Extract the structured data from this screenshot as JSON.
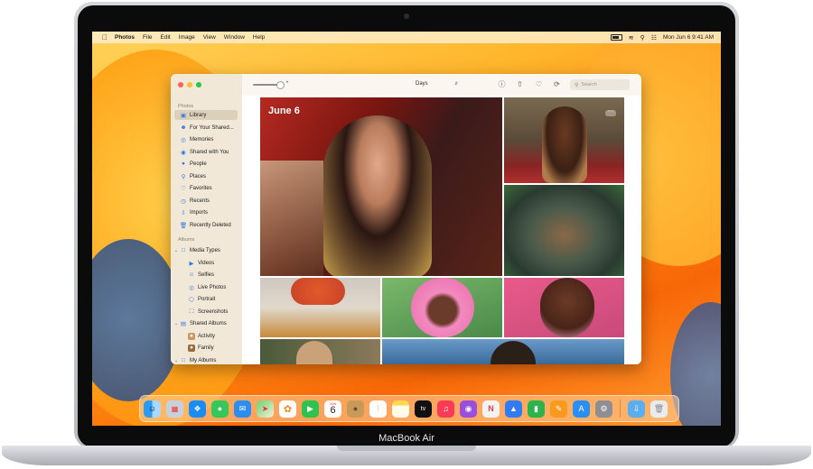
{
  "device": {
    "brand_label": "MacBook Air"
  },
  "menubar": {
    "apple_icon": "apple-icon",
    "items": [
      "Photos",
      "File",
      "Edit",
      "Image",
      "View",
      "Window",
      "Help"
    ],
    "clock": "Mon Jun 6  9:41 AM",
    "status_icons": [
      "battery-icon",
      "wifi-icon",
      "search-icon",
      "control-center-icon"
    ]
  },
  "window": {
    "traffic_lights": {
      "close": "#ff5f57",
      "minimize": "#febc2e",
      "zoom": "#28c840"
    },
    "sidebar": {
      "section_photos": "Photos",
      "items": [
        {
          "label": "Library",
          "icon": "library-icon",
          "active": true
        },
        {
          "label": "For Your Shared...",
          "icon": "people-icon"
        },
        {
          "label": "Memories",
          "icon": "memories-icon"
        },
        {
          "label": "Shared with You",
          "icon": "shared-icon"
        },
        {
          "label": "People",
          "icon": "person-icon"
        },
        {
          "label": "Places",
          "icon": "pin-icon"
        },
        {
          "label": "Favorites",
          "icon": "heart-icon"
        },
        {
          "label": "Recents",
          "icon": "clock-icon"
        },
        {
          "label": "Imports",
          "icon": "import-icon"
        },
        {
          "label": "Recently Deleted",
          "icon": "trash-icon"
        }
      ],
      "section_albums": "Albums",
      "album_items": [
        {
          "label": "Media Types",
          "icon": "folder-icon",
          "chevron": true
        },
        {
          "label": "Videos",
          "icon": "video-icon",
          "sub": true
        },
        {
          "label": "Selfies",
          "icon": "selfie-icon",
          "sub": true
        },
        {
          "label": "Live Photos",
          "icon": "live-icon",
          "sub": true
        },
        {
          "label": "Portrait",
          "icon": "cube-icon",
          "sub": true
        },
        {
          "label": "Screenshots",
          "icon": "screenshot-icon",
          "sub": true
        },
        {
          "label": "Shared Albums",
          "icon": "shared-album-icon",
          "chevron": true
        },
        {
          "label": "Activity",
          "icon": "activity-icon",
          "sub": true
        },
        {
          "label": "Family",
          "icon": "family-icon",
          "sub": true
        },
        {
          "label": "My Albums",
          "icon": "folder-icon",
          "chevron": true
        }
      ]
    },
    "toolbar": {
      "view_select": "Days",
      "search_placeholder": "Search",
      "icons": [
        "info-icon",
        "share-icon",
        "heart-icon",
        "rotate-icon"
      ]
    },
    "content": {
      "date_label": "June 6",
      "more_label": "···"
    }
  },
  "dock": {
    "apps": [
      {
        "name": "finder-icon",
        "color": "#1e8cf0"
      },
      {
        "name": "launchpad-icon",
        "color": "#c9d0dd"
      },
      {
        "name": "safari-icon",
        "color": "#1a8cf5"
      },
      {
        "name": "messages-icon",
        "color": "#34c759"
      },
      {
        "name": "mail-icon",
        "color": "#2d8ef1"
      },
      {
        "name": "maps-icon",
        "color": "#6fcf70"
      },
      {
        "name": "photos-icon",
        "color": "#ffffff"
      },
      {
        "name": "facetime-icon",
        "color": "#2fc24f"
      },
      {
        "name": "calendar-icon",
        "color": "#ffffff"
      },
      {
        "name": "contacts-icon",
        "color": "#c79a5a"
      },
      {
        "name": "reminders-icon",
        "color": "#ffffff"
      },
      {
        "name": "notes-icon",
        "color": "#ffd84d"
      },
      {
        "name": "tv-icon",
        "color": "#111111"
      },
      {
        "name": "music-icon",
        "color": "#fa3b56"
      },
      {
        "name": "podcasts-icon",
        "color": "#9b4ddb"
      },
      {
        "name": "news-icon",
        "color": "#f3f3f3"
      },
      {
        "name": "keynote-icon",
        "color": "#2f7cf6"
      },
      {
        "name": "numbers-icon",
        "color": "#2cb34a"
      },
      {
        "name": "pages-icon",
        "color": "#f79a1e"
      },
      {
        "name": "app-store-icon",
        "color": "#2b8ef3"
      },
      {
        "name": "system-settings-icon",
        "color": "#8e8e93"
      }
    ],
    "calendar_month": "JUN",
    "calendar_day": "6",
    "tv_label": "tv",
    "trailing": [
      {
        "name": "downloads-folder-icon",
        "color": "#5aaeef"
      },
      {
        "name": "trash-icon",
        "color": "#e9ecef"
      }
    ]
  }
}
